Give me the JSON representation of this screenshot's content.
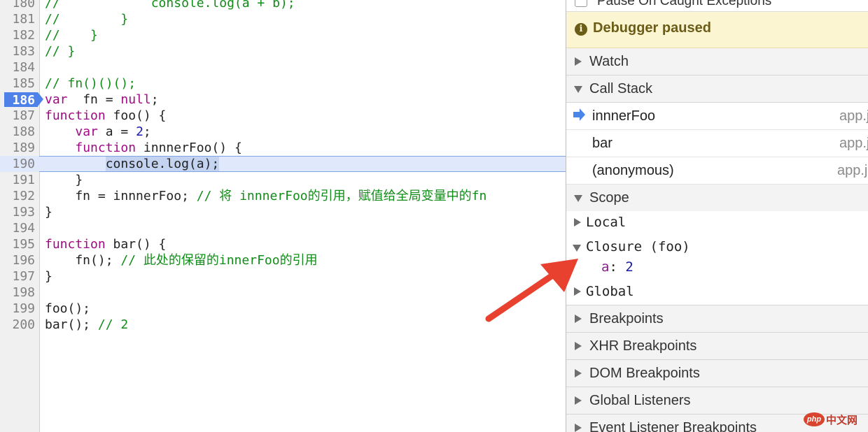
{
  "editor": {
    "lines": [
      {
        "n": "180",
        "code": [
          [
            "cmt",
            "//            console.log(a + b);"
          ]
        ]
      },
      {
        "n": "181",
        "code": [
          [
            "cmt",
            "//        }"
          ]
        ]
      },
      {
        "n": "182",
        "code": [
          [
            "cmt",
            "//    }"
          ]
        ]
      },
      {
        "n": "183",
        "code": [
          [
            "cmt",
            "// }"
          ]
        ]
      },
      {
        "n": "184",
        "code": []
      },
      {
        "n": "185",
        "code": [
          [
            "cmt",
            "// fn()()();"
          ]
        ]
      },
      {
        "n": "186",
        "bp": true,
        "code": [
          [
            "kw",
            "var"
          ],
          [
            "",
            "  fn = "
          ],
          [
            "kw",
            "null"
          ],
          [
            "",
            ";"
          ]
        ]
      },
      {
        "n": "187",
        "code": [
          [
            "kw",
            "function"
          ],
          [
            "",
            " foo() {"
          ]
        ]
      },
      {
        "n": "188",
        "code": [
          [
            "",
            "    "
          ],
          [
            "kw",
            "var"
          ],
          [
            "",
            " a = "
          ],
          [
            "num",
            "2"
          ],
          [
            "",
            ";"
          ]
        ]
      },
      {
        "n": "189",
        "code": [
          [
            "",
            "    "
          ],
          [
            "kw",
            "function"
          ],
          [
            "",
            " innnerFoo() {"
          ]
        ]
      },
      {
        "n": "190",
        "exec": true,
        "code": [
          [
            "",
            "        "
          ],
          [
            "selected",
            "console.log(a);"
          ]
        ]
      },
      {
        "n": "191",
        "code": [
          [
            "",
            "    }"
          ]
        ]
      },
      {
        "n": "192",
        "code": [
          [
            "",
            "    fn = innnerFoo; "
          ],
          [
            "cmt",
            "// 将 innnerFoo的引用，赋值给全局变量中的fn"
          ]
        ]
      },
      {
        "n": "193",
        "code": [
          [
            "",
            "}"
          ]
        ]
      },
      {
        "n": "194",
        "code": []
      },
      {
        "n": "195",
        "code": [
          [
            "kw",
            "function"
          ],
          [
            "",
            " bar() {"
          ]
        ]
      },
      {
        "n": "196",
        "code": [
          [
            "",
            "    fn(); "
          ],
          [
            "cmt",
            "// 此处的保留的innerFoo的引用"
          ]
        ]
      },
      {
        "n": "197",
        "code": [
          [
            "",
            "}"
          ]
        ]
      },
      {
        "n": "198",
        "code": []
      },
      {
        "n": "199",
        "code": [
          [
            "",
            "foo();"
          ]
        ]
      },
      {
        "n": "200",
        "code": [
          [
            "",
            "bar(); "
          ],
          [
            "cmt",
            "// 2"
          ]
        ]
      }
    ]
  },
  "sidebar": {
    "pause_on_caught": "Pause On Caught Exceptions",
    "paused_banner": "Debugger paused",
    "info_icon": "i",
    "watch": "Watch",
    "call_stack": {
      "title": "Call Stack",
      "frames": [
        {
          "fn": "innnerFoo",
          "file": "app.js"
        },
        {
          "fn": "bar",
          "file": "app.js"
        },
        {
          "fn": "(anonymous)",
          "file": "app.js"
        }
      ]
    },
    "scope": {
      "title": "Scope",
      "local": "Local",
      "closure": "Closure (foo)",
      "closure_prop_name": "a",
      "closure_prop_value": "2",
      "global": "Global"
    },
    "breakpoints": "Breakpoints",
    "xhr_breakpoints": "XHR Breakpoints",
    "dom_breakpoints": "DOM Breakpoints",
    "global_listeners": "Global Listeners",
    "event_listener_breakpoints": "Event Listener Breakpoints"
  },
  "watermark": {
    "logo": "php",
    "text": "中文网"
  },
  "colors": {
    "accent_blue": "#4f82e9",
    "comment": "#128c19",
    "keyword": "#a10985",
    "annotation_arrow": "#e8412f"
  }
}
